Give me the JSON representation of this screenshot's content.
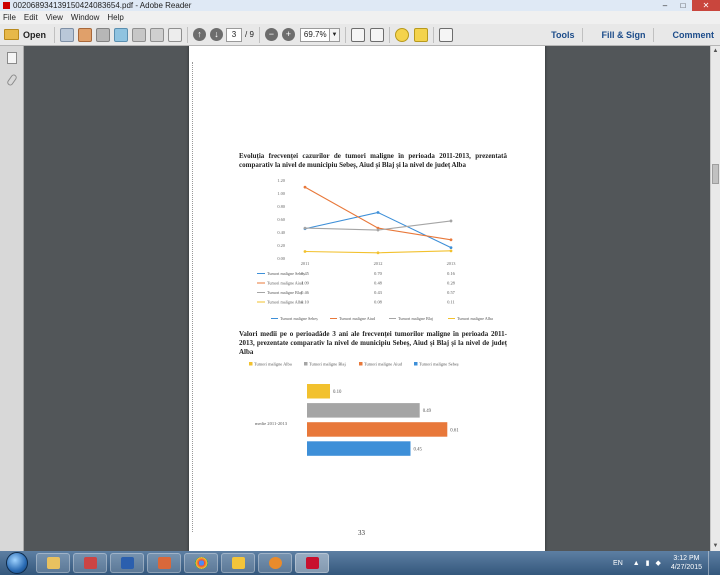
{
  "window": {
    "title": "0020689341391504240836​54.pdf - Adobe Reader",
    "controls": [
      "–",
      "□",
      "✕"
    ]
  },
  "menu": [
    "File",
    "Edit",
    "View",
    "Window",
    "Help"
  ],
  "toolbar": {
    "open_label": "Open",
    "page_current": "3",
    "page_total": "/ 9",
    "zoom": "69.7%",
    "tools_label": "Tools",
    "fill_sign_label": "Fill & Sign",
    "comment_label": "Comment"
  },
  "document": {
    "heading1": "Evoluția frecvenței cazurilor de tumori maligne în perioada 2011-2013, prezentată comparativ la nivel de municipiu Sebeș, Aiud și Blaj și la nivel de județ Alba",
    "heading2": "Valori medii pe o perioadăde 3 ani ale frecvenței tumorilor maligne în perioada 2011-2013, prezentate comparativ la nivel de municipiu Sebeș, Aiud și Blaj și la nivel de județ Alba",
    "page_number": "33"
  },
  "chart_data": [
    {
      "type": "line",
      "title": "",
      "x": [
        "2011",
        "2012",
        "2013"
      ],
      "ylim": [
        0,
        1.2
      ],
      "yticks": [
        "1.20",
        "1.00",
        "0.80",
        "0.60",
        "0.40",
        "0.20",
        "0.00"
      ],
      "series": [
        {
          "name": "Tumori maligne Sebeș",
          "values": [
            0.45,
            0.7,
            0.16
          ],
          "color": "#3d8fd8"
        },
        {
          "name": "Tumori maligne Aiud",
          "values": [
            1.09,
            0.46,
            0.28
          ],
          "color": "#e8783a"
        },
        {
          "name": "Tumori maligne Blaj",
          "values": [
            0.46,
            0.43,
            0.57
          ],
          "color": "#a5a5a5"
        },
        {
          "name": "Tumori maligne Alba",
          "values": [
            0.1,
            0.08,
            0.11
          ],
          "color": "#f2c12e"
        }
      ],
      "table": [
        {
          "label": "Tumori maligne Sebeș",
          "values": [
            "0.45",
            "0.70",
            "0.16"
          ]
        },
        {
          "label": "Tumori maligne Aiud",
          "values": [
            "1.09",
            "0.48",
            "0.28"
          ]
        },
        {
          "label": "Tumori maligne Blaj",
          "values": [
            "0.46",
            "0.43",
            "0.57"
          ]
        },
        {
          "label": "Tumori maligne Alba",
          "values": [
            "0.10",
            "0.08",
            "0.11"
          ]
        }
      ],
      "legend": [
        "Tumori maligne Sebeș",
        "Tumori maligne Aiud",
        "Tumori maligne Blaj",
        "Tumori maligne Alba"
      ]
    },
    {
      "type": "bar",
      "orientation": "horizontal",
      "category_label": "medie 2011-2013",
      "legend": [
        "Tumori maligne Alba",
        "Tumori maligne Blaj",
        "Tumori maligne Aiud",
        "Tumori maligne Sebeș"
      ],
      "series": [
        {
          "name": "Tumori maligne Alba",
          "value": 0.1,
          "label": "0.10",
          "color": "#f2c12e"
        },
        {
          "name": "Tumori maligne Blaj",
          "value": 0.49,
          "label": "0.49",
          "color": "#a5a5a5"
        },
        {
          "name": "Tumori maligne Aiud",
          "value": 0.61,
          "label": "0.61",
          "color": "#e8783a"
        },
        {
          "name": "Tumori maligne Sebeș",
          "value": 0.45,
          "label": "0.45",
          "color": "#3d8fd8"
        }
      ]
    }
  ],
  "taskbar": {
    "language": "EN",
    "time": "3:12 PM",
    "date": "4/27/2015"
  }
}
